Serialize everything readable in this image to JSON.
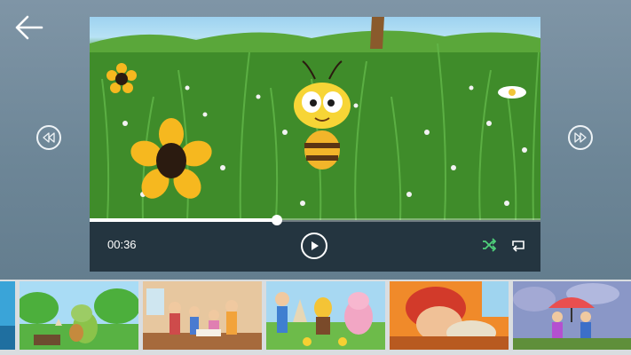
{
  "player": {
    "current_time": "00:36",
    "progress_fraction": 0.415
  },
  "icons": {
    "back": "back-arrow-icon",
    "previous": "rewind-icon",
    "next": "fast-forward-icon",
    "play": "play-icon",
    "shuffle": "shuffle-icon",
    "repeat": "repeat-icon"
  },
  "colors": {
    "shuffle_accent": "#4fd07a",
    "background": "#6d8697",
    "control_bar": "#24343f"
  },
  "playlist": {
    "thumbnails": [
      {
        "scene": "partial-left"
      },
      {
        "scene": "frog-guitar-park"
      },
      {
        "scene": "kids-birthday-party"
      },
      {
        "scene": "farmer-pig-ducks"
      },
      {
        "scene": "sleeping-boy-red-hat"
      },
      {
        "scene": "kids-umbrella-rain"
      }
    ]
  }
}
